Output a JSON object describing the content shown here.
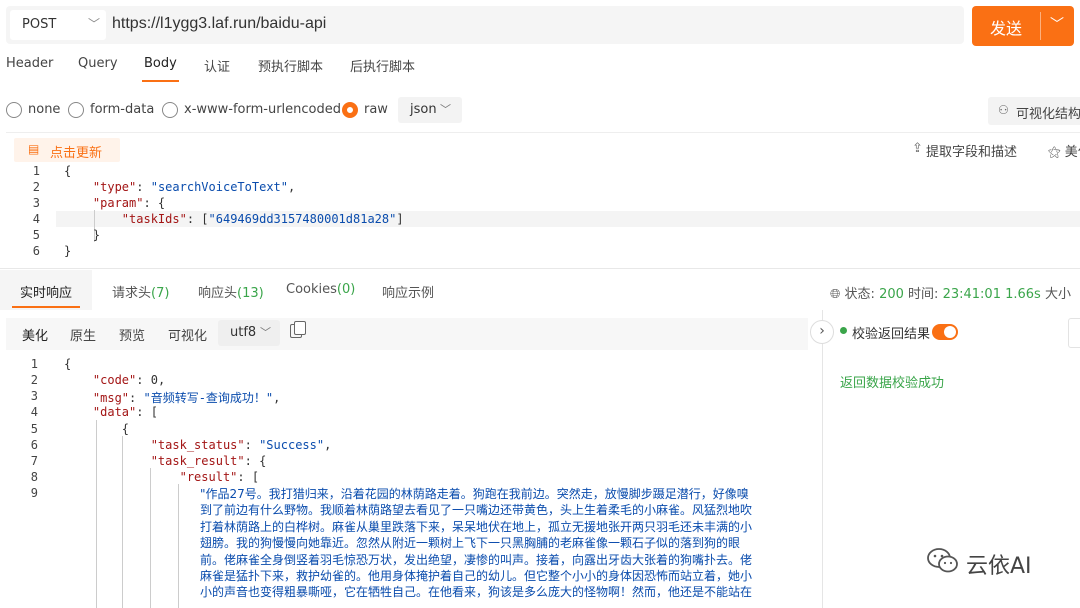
{
  "request": {
    "method": "POST",
    "url": "https://l1ygg3.laf.run/baidu-api",
    "send_label": "发送",
    "tabs": [
      "Header",
      "Query",
      "Body",
      "认证",
      "预执行脚本",
      "后执行脚本"
    ],
    "active_tab": "Body",
    "body_types": [
      "none",
      "form-data",
      "x-www-form-urlencoded",
      "raw"
    ],
    "selected_body_type": "raw",
    "format": "json",
    "visual_structure_label": "可视化结构",
    "update_label": "点击更新",
    "extract_label": "提取字段和描述",
    "beautify_label": "美化",
    "line_numbers": [
      "1",
      "2",
      "3",
      "4",
      "5",
      "6"
    ],
    "code_lines": [
      "{",
      "    \"type\": \"searchVoiceToText\",",
      "    \"param\": {",
      "        \"taskIds\": [\"649469dd3157480001d81a28\"]",
      "    }",
      "}"
    ]
  },
  "response": {
    "tabs": [
      {
        "label": "实时响应",
        "count": ""
      },
      {
        "label": "请求头",
        "count": "(7)"
      },
      {
        "label": "响应头",
        "count": "(13)"
      },
      {
        "label": "Cookies",
        "count": "(0)"
      },
      {
        "label": "响应示例",
        "count": ""
      }
    ],
    "status_label": "状态:",
    "status_value": "200",
    "time_label": "时间:",
    "time_value": "23:41:01",
    "duration": "1.66s",
    "size_label": "大小",
    "view_modes": [
      "美化",
      "原生",
      "预览",
      "可视化"
    ],
    "encoding": "utf8",
    "verify_label": "校验返回结果",
    "verify_success": "返回数据校验成功",
    "line_numbers": [
      "1",
      "2",
      "3",
      "4",
      "5",
      "6",
      "7",
      "8",
      "9"
    ],
    "code_lines": [
      "{",
      "    \"code\": 0,",
      "    \"msg\": \"音频转写-查询成功！\",",
      "    \"data\": [",
      "        {",
      "            \"task_status\": \"Success\",",
      "            \"task_result\": {",
      "                \"result\": ["
    ],
    "result_text_lines": [
      "\"作品27号。我打猎归来，沿着花园的林荫路走着。狗跑在我前边。突然走，放慢脚步蹑足潜行，好像嗅",
      "到了前边有什么野物。我顺着林荫路望去看见了一只嘴边还带黄色，头上生着柔毛的小麻雀。风猛烈地吹",
      "打着林荫路上的白桦树。麻雀从巢里跌落下来，呆呆地伏在地上，孤立无援地张开两只羽毛还未丰满的小",
      "翅膀。我的狗慢慢向她靠近。忽然从附近一颗树上飞下一只黑胸脯的老麻雀像一颗石子似的落到狗的眼",
      "前。佬麻雀全身倒竖着羽毛惊恐万状，发出绝望，凄惨的叫声。接着，向露出牙齿大张着的狗嘴扑去。佬",
      "麻雀是猛扑下来，救护幼雀的。他用身体掩护着自己的幼儿。但它整个小小的身体因恐怖而站立着，她小",
      "小的声音也变得粗暴嘶哑，它在牺牲自己。在他看来，狗该是多么庞大的怪物啊！然而，他还是不能站在"
    ]
  },
  "watermark": "云依AI",
  "colors": {
    "accent": "#fa7014",
    "success": "#3aa54a",
    "string": "#0a4cad",
    "key": "#a31515"
  }
}
